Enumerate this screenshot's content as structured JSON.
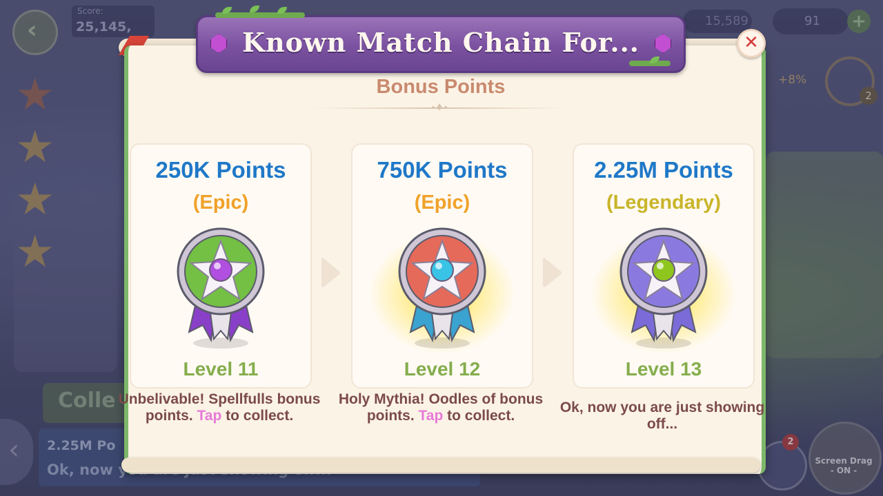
{
  "background": {
    "score_label": "Score:",
    "score_value": "25,145,",
    "coins": "15,589",
    "gems": "91",
    "bonus_percent": "+8%",
    "timer_count": "2",
    "collect_label": "Colle",
    "banner_line1": "2.25M Po",
    "banner_line2": "Ok, now you are just showing off...",
    "screen_drag_label": "Screen Drag",
    "screen_drag_state": "- ON -",
    "hero_badge_count": "2"
  },
  "modal": {
    "title": "Known Match Chain For...",
    "subtitle": "Bonus Points",
    "close_symbol": "✕",
    "cards": [
      {
        "points": "250K Points",
        "rarity": "(Epic)",
        "level": "Level 11",
        "desc_before": "Unbelivable! Spellfulls bonus points. ",
        "desc_tap": "Tap",
        "desc_after": " to collect.",
        "medal_colors": {
          "center": "#b04fe0",
          "ring": "#73c044",
          "ribbon": "#8a3fc9"
        },
        "glow": false
      },
      {
        "points": "750K Points",
        "rarity": "(Epic)",
        "level": "Level 12",
        "desc_before": "Holy Mythia! Oodles of bonus points. ",
        "desc_tap": "Tap",
        "desc_after": " to collect.",
        "medal_colors": {
          "center": "#39c3e6",
          "ring": "#e56a5a",
          "ribbon": "#3aa3d0"
        },
        "glow": true
      },
      {
        "points": "2.25M Points",
        "rarity": "(Legendary)",
        "level": "Level 13",
        "desc_before": "Ok, now you are just showing off...",
        "desc_tap": "",
        "desc_after": "",
        "medal_colors": {
          "center": "#8fc61e",
          "ring": "#8a7ae0",
          "ribbon": "#7b6bd8"
        },
        "glow": true
      }
    ]
  },
  "colors": {
    "title_banner": "#7a51a0",
    "points_blue": "#1f78c8",
    "epic_orange": "#f0a22a",
    "legendary_yellow": "#c9b52a",
    "level_green": "#84ad4c",
    "tap_pink": "#e87ad8"
  }
}
